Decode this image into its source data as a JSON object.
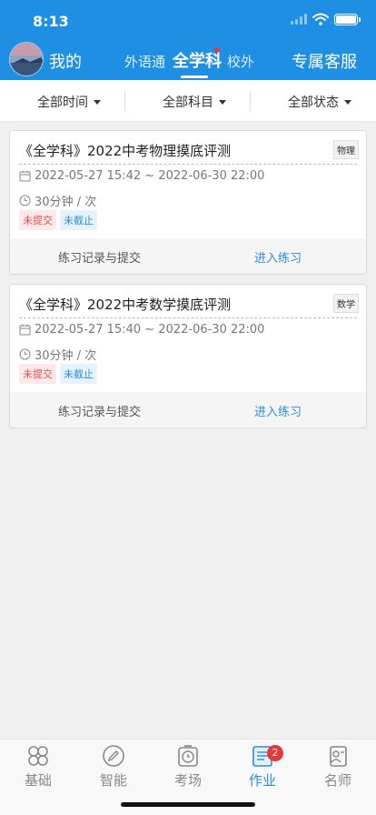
{
  "status": {
    "time": "8:13"
  },
  "header": {
    "me_label": "我的",
    "tabs": [
      "外语通",
      "全学科",
      "校外"
    ],
    "active_tab": "全学科",
    "service_label": "专属客服"
  },
  "filters": [
    "全部时间",
    "全部科目",
    "全部状态"
  ],
  "cards": [
    {
      "title": "《全学科》2022中考物理摸底评测",
      "subject": "物理",
      "time_range": "2022-05-27 15:42 ~ 2022-06-30 22:00",
      "duration": "30分钟 / 次",
      "badges": [
        "未提交",
        "未截止"
      ],
      "record_label": "练习记录与提交",
      "enter_label": "进入练习"
    },
    {
      "title": "《全学科》2022中考数学摸底评测",
      "subject": "数学",
      "time_range": "2022-05-27 15:40 ~ 2022-06-30 22:00",
      "duration": "30分钟 / 次",
      "badges": [
        "未提交",
        "未截止"
      ],
      "record_label": "练习记录与提交",
      "enter_label": "进入练习"
    }
  ],
  "tabbar": {
    "items": [
      {
        "label": "基础",
        "icon": "grid-icon"
      },
      {
        "label": "智能",
        "icon": "pencil-icon"
      },
      {
        "label": "考场",
        "icon": "clock-icon"
      },
      {
        "label": "作业",
        "icon": "homework-icon",
        "badge": "2"
      },
      {
        "label": "名师",
        "icon": "teacher-icon"
      }
    ],
    "active": "作业"
  },
  "colors": {
    "brand": "#1e8fe3",
    "accent_blue": "#2a8de0",
    "badge_red": "#e05050"
  }
}
